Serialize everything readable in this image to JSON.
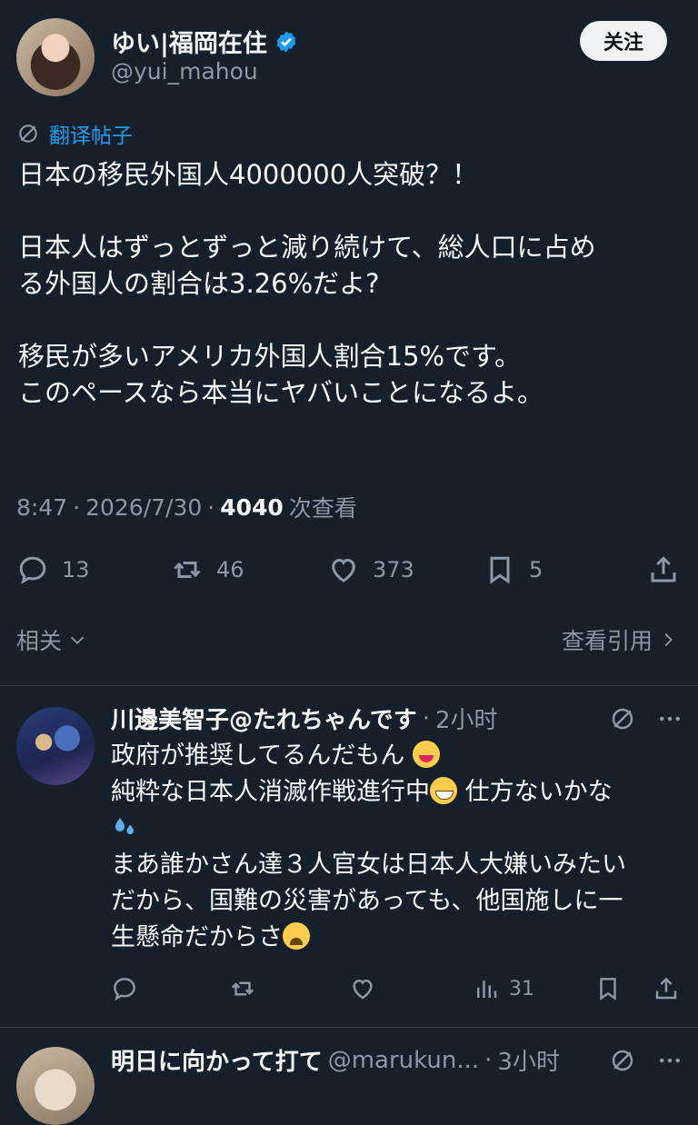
{
  "post": {
    "author_name": "ゆい|福岡在住",
    "author_handle": "@yui_mahou",
    "follow_label": "关注",
    "translate_label": "翻译帖子",
    "body_lines": [
      "日本の移民外国人4000000人突破？！",
      "",
      "日本人はずっとずっと減り続けて、総人口に占め",
      "る外国人の割合は3.26%だよ?",
      "",
      "移民が多いアメリカ外国人割合15%です。",
      "このペースなら本当にヤバいことになるよ。"
    ],
    "time": "8:47",
    "date": "2026/7/30",
    "views": "4040",
    "views_label": "次查看",
    "replies": "13",
    "reposts": "46",
    "likes": "373",
    "bookmarks": "5",
    "related_label": "相关",
    "quotes_label": "查看引用"
  },
  "replies": [
    {
      "name": "川邊美智子@たれちゃんです",
      "time": "2小时",
      "lines": [
        "政府が推奨してるんだもん",
        "純粋な日本人消滅作戦進行中",
        "仕方ないかな",
        "まあ誰かさん達３人官女は日本人大嫌いみたい",
        "だから、国難の災害があっても、他国施しに一",
        "生懸命だからさ"
      ],
      "views": "31"
    },
    {
      "name": "明日に向かって打て",
      "handle": "@marukun...",
      "time": "3小时"
    }
  ],
  "icons": {
    "verified": "verified-badge-icon",
    "translate": "translate-icon",
    "reply": "comment-icon",
    "repost": "repost-icon",
    "like": "heart-icon",
    "bookmark": "bookmark-icon",
    "share": "share-icon",
    "more": "more-icon",
    "views": "analytics-icon"
  },
  "colors": {
    "background": "#15202b",
    "accent": "#1d9bf0",
    "muted": "#8b98a5",
    "divider": "#38444d"
  }
}
